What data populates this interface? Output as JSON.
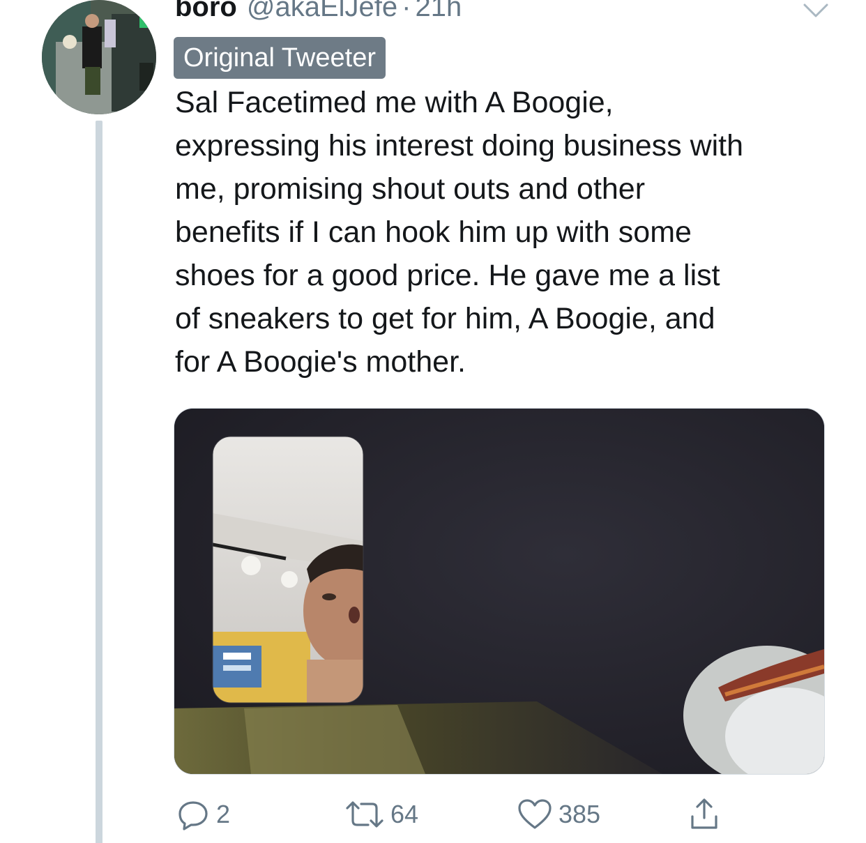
{
  "tweet": {
    "display_name": "boro",
    "handle": "@akaElJefe",
    "separator": "·",
    "time": "21h",
    "badge": "Original Tweeter",
    "text_lines": [
      "Sal Facetimed me with A Boogie,",
      "expressing his interest doing business with",
      "me, promising shout outs and other",
      "benefits if I can hook him up with some",
      "shoes for a good price. He gave me a list",
      "of sneakers to get for him, A Boogie, and",
      "for A Boogie's mother."
    ]
  },
  "actions": {
    "replies": "2",
    "retweets": "64",
    "likes": "385"
  },
  "icons": [
    "chevron-down-icon",
    "reply-icon",
    "retweet-icon",
    "like-icon",
    "share-icon"
  ],
  "colors": {
    "text": "#14171a",
    "secondary": "#657786",
    "badge_bg": "#6e7b86",
    "thread_line": "#ccd6dd"
  }
}
